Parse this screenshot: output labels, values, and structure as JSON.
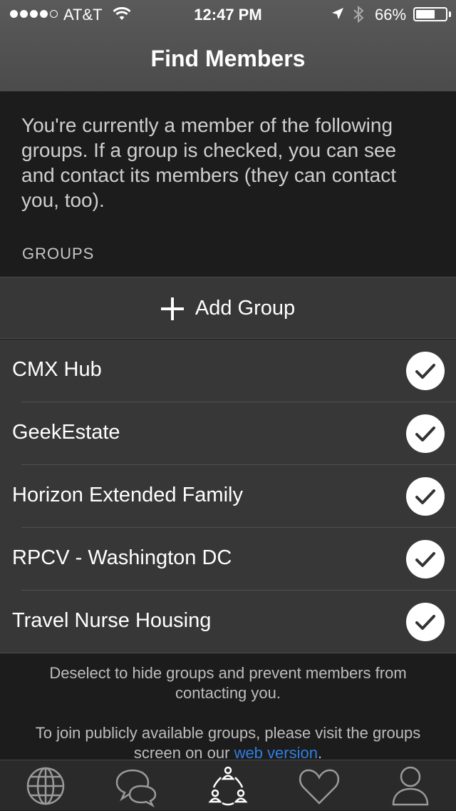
{
  "status_bar": {
    "carrier": "AT&T",
    "time": "12:47 PM",
    "battery_percent": "66%",
    "battery_level": 0.66,
    "signal_bars_filled": 4,
    "signal_bars_total": 5
  },
  "header": {
    "title": "Find Members"
  },
  "intro": "You're currently a member of the following groups. If a group is checked, you can see and contact its members (they can contact you, too).",
  "groups_section": {
    "header": "GROUPS",
    "add_label": "Add Group",
    "items": [
      {
        "label": "CMX Hub",
        "checked": true
      },
      {
        "label": "GeekEstate",
        "checked": true
      },
      {
        "label": "Horizon Extended Family",
        "checked": true
      },
      {
        "label": "RPCV - Washington DC",
        "checked": true
      },
      {
        "label": "Travel Nurse Housing",
        "checked": true
      }
    ]
  },
  "footer": {
    "deselect_note": "Deselect to hide groups and prevent members from contacting you.",
    "join_note_prefix": "To join publicly available groups, please visit the groups screen on our ",
    "join_link": "web version",
    "join_note_suffix": "."
  },
  "tab_bar": {
    "tabs": [
      {
        "icon": "globe-icon",
        "active": false
      },
      {
        "icon": "chat-bubbles-icon",
        "active": false
      },
      {
        "icon": "group-network-icon",
        "active": true
      },
      {
        "icon": "heart-icon",
        "active": false
      },
      {
        "icon": "person-icon",
        "active": false
      }
    ]
  },
  "colors": {
    "link": "#2f7fe0",
    "background": "#1c1c1c",
    "row": "#373737"
  }
}
